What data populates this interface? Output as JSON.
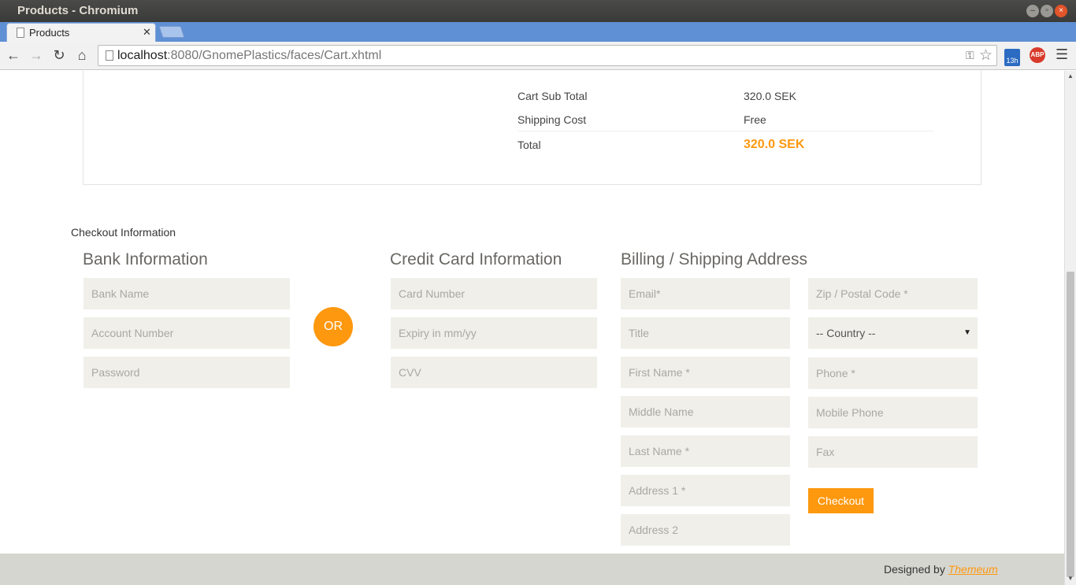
{
  "window": {
    "title": "Products - Chromium"
  },
  "tab": {
    "label": "Products"
  },
  "omnibox": {
    "host": "localhost",
    "rest": ":8080/GnomePlastics/faces/Cart.xhtml"
  },
  "extensions": {
    "calendar_badge": "13h",
    "adblock_label": "ABP"
  },
  "totals": [
    {
      "label": "Cart Sub Total",
      "value": "320.0 SEK"
    },
    {
      "label": "Shipping Cost",
      "value": "Free"
    },
    {
      "label": "Total",
      "value": "320.0 SEK"
    }
  ],
  "checkout": {
    "section_title": "Checkout Information",
    "bank": {
      "heading": "Bank Information",
      "fields": [
        "Bank Name",
        "Account Number",
        "Password"
      ]
    },
    "or_label": "OR",
    "card": {
      "heading": "Credit Card Information",
      "fields": [
        "Card Number",
        "Expiry in mm/yy",
        "CVV"
      ]
    },
    "address": {
      "heading": "Billing / Shipping Address",
      "left_fields": [
        "Email*",
        "Title",
        "First Name *",
        "Middle Name",
        "Last Name *",
        "Address 1 *",
        "Address 2"
      ],
      "right_fields": [
        "Zip / Postal Code *",
        "Phone *",
        "Mobile Phone",
        "Fax"
      ],
      "country_selected": "-- Country --"
    },
    "button_label": "Checkout"
  },
  "footer": {
    "prefix": "Designed by ",
    "link": "Themeum"
  },
  "colors": {
    "accent": "#fe980f",
    "field_bg": "#f0efe9",
    "footer_bg": "#d6d6d0"
  }
}
